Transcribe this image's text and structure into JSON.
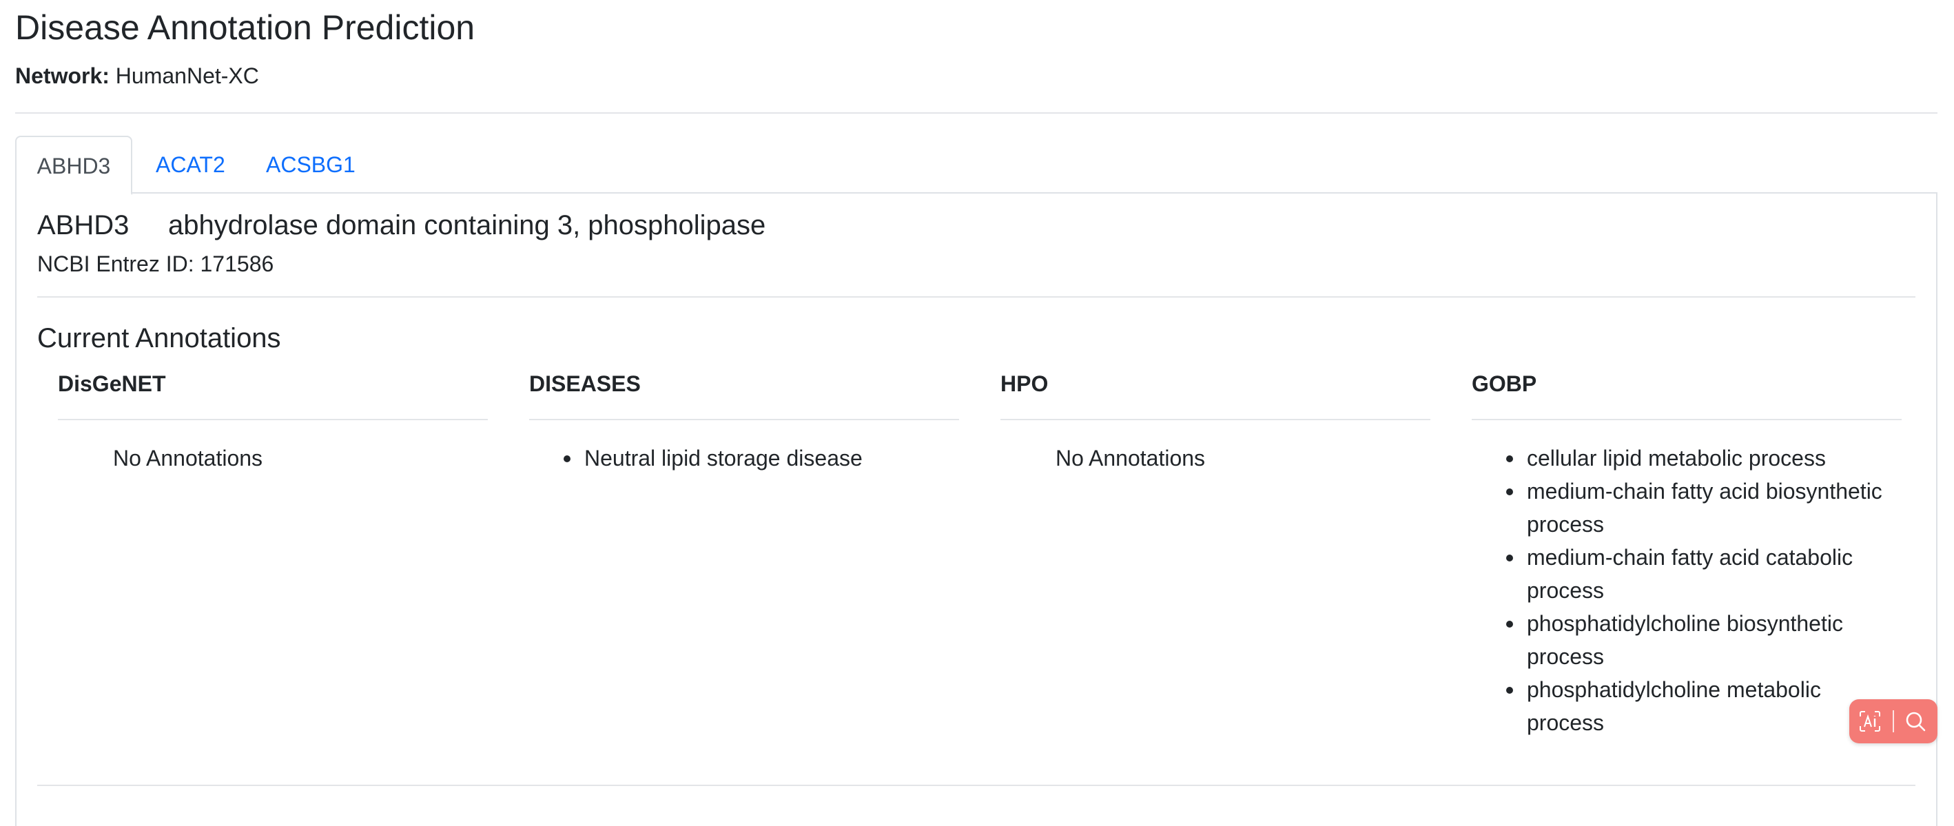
{
  "page": {
    "title": "Disease Annotation Prediction",
    "network_label": "Network:",
    "network_value": "HumanNet-XC"
  },
  "tabs": [
    {
      "label": "ABHD3",
      "active": true
    },
    {
      "label": "ACAT2",
      "active": false
    },
    {
      "label": "ACSBG1",
      "active": false
    }
  ],
  "gene": {
    "symbol": "ABHD3",
    "name": "abhydrolase domain containing 3, phospholipase",
    "entrez_text": "NCBI Entrez ID: 171586"
  },
  "annotations": {
    "section_title": "Current Annotations",
    "columns": [
      {
        "title": "DisGeNET",
        "none_text": "No Annotations",
        "items": []
      },
      {
        "title": "DISEASES",
        "items": [
          "Neutral lipid storage disease"
        ]
      },
      {
        "title": "HPO",
        "none_text": "No Annotations",
        "items": []
      },
      {
        "title": "GOBP",
        "items": [
          "cellular lipid metabolic process",
          "medium-chain fatty acid biosynthetic process",
          "medium-chain fatty acid catabolic process",
          "phosphatidylcholine biosynthetic process",
          "phosphatidylcholine metabolic process"
        ]
      }
    ]
  },
  "floating_button": {
    "icons": [
      "ai-icon",
      "search-icon"
    ],
    "color": "#f47b76"
  },
  "colors": {
    "link": "#0d6efd",
    "text": "#212529",
    "border": "#dee2e6"
  }
}
